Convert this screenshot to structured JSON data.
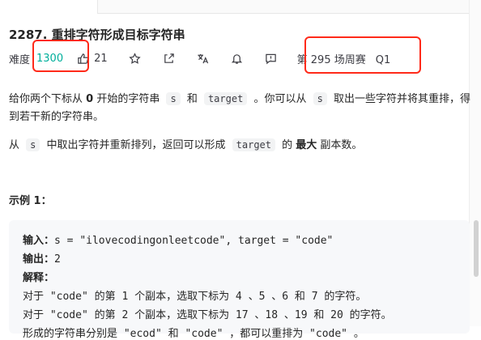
{
  "problem": {
    "title": "2287. 重排字符形成目标字符串",
    "difficulty_label": "难度",
    "difficulty_value": "1300",
    "likes": "21",
    "contest": "第 295 场周赛",
    "contest_q": "Q1"
  },
  "description": {
    "p1": {
      "t1": "给你两个下标从 ",
      "b1": "0",
      "t2": " 开始的字符串 ",
      "c1": "s",
      "t3": " 和 ",
      "c2": "target",
      "t4": " 。你可以从 ",
      "c3": "s",
      "t5": " 取出一些字符并将其重排，得到若干新的字符串。"
    },
    "p2": {
      "t1": "从 ",
      "c1": "s",
      "t2": " 中取出字符并重新排列，返回可以形成 ",
      "c2": "target",
      "t3": " 的 ",
      "b1": "最大",
      "t4": " 副本数。"
    }
  },
  "example": {
    "title": "示例 1：",
    "input_label": "输入：",
    "input_value": "s = \"ilovecodingonleetcode\", target = \"code\"",
    "output_label": "输出：",
    "output_value": "2",
    "explain_label": "解释：",
    "line1": "对于 \"code\" 的第 1 个副本，选取下标为 4 、5 、6 和 7 的字符。",
    "line2": "对于 \"code\" 的第 2 个副本，选取下标为 17 、18 、19 和 20 的字符。",
    "line3": "形成的字符串分别是 \"ecod\" 和 \"code\" ，都可以重排为 \"code\" 。"
  },
  "colors": {
    "difficulty": "#00af9b",
    "highlight_box": "#ff2a1a"
  },
  "icons": [
    "thumbs-up-icon",
    "star-icon",
    "share-icon",
    "translate-icon",
    "bell-icon",
    "feedback-icon"
  ]
}
